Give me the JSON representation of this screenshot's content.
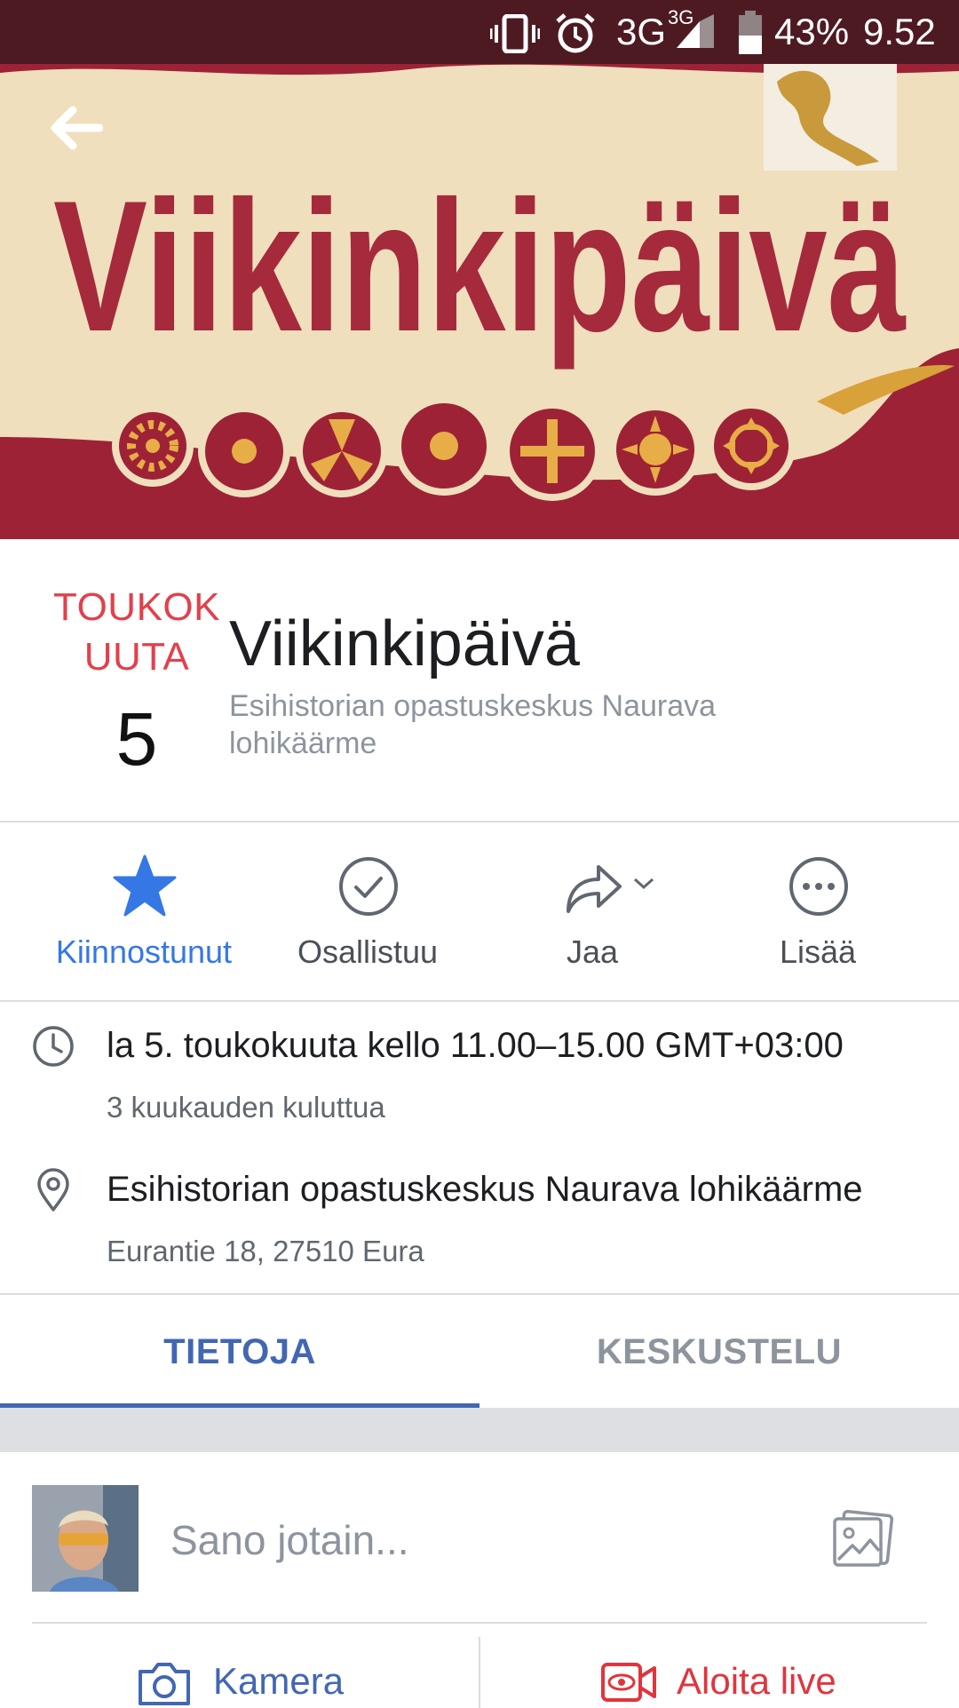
{
  "status_bar": {
    "network": "3G",
    "network_small": "3G",
    "battery": "43%",
    "time": "9.52"
  },
  "cover": {
    "title": "Viikinkipäivä"
  },
  "event": {
    "date_month": "TOUKOK\nUUTA",
    "date_day": "5",
    "title": "Viikinkipäivä",
    "host": "Esihistorian opastuskeskus Naurava lohikäärme"
  },
  "actions": [
    {
      "label": "Kiinnostunut",
      "icon": "star-icon",
      "active": true
    },
    {
      "label": "Osallistuu",
      "icon": "check-circle-icon",
      "active": false
    },
    {
      "label": "Jaa",
      "icon": "share-icon",
      "active": false
    },
    {
      "label": "Lisää",
      "icon": "more-icon",
      "active": false
    }
  ],
  "info": {
    "time_main": "la 5. toukokuuta kello 11.00–15.00 GMT+03:00",
    "time_sub": "3 kuukauden kuluttua",
    "place_main": "Esihistorian opastuskeskus Naurava lohikäärme",
    "place_sub": "Eurantie 18, 27510 Eura"
  },
  "tabs": [
    {
      "label": "TIETOJA",
      "active": true
    },
    {
      "label": "KESKUSTELU",
      "active": false
    }
  ],
  "composer": {
    "placeholder": "Sano jotain..."
  },
  "bottom_buttons": {
    "camera": "Kamera",
    "live": "Aloita live"
  },
  "colors": {
    "accent": "#4267b2",
    "action_active": "#3578e5",
    "date_red": "#e2404b",
    "live_red": "#e0353d",
    "banner_red": "#9e2235",
    "banner_cream": "#f0dfbd"
  }
}
